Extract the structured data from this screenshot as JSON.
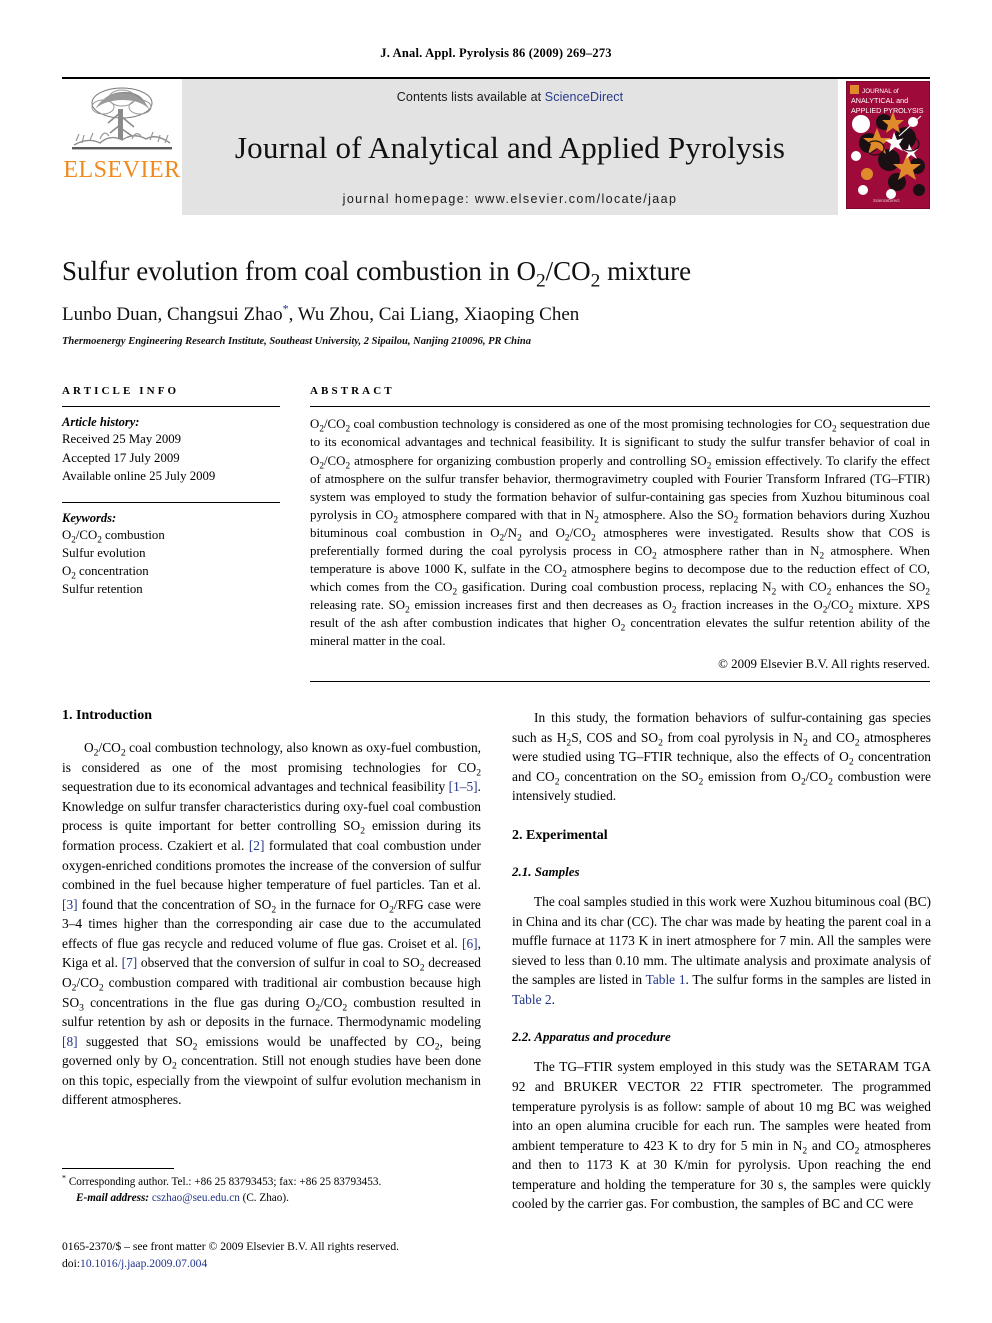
{
  "running_head": "J. Anal. Appl. Pyrolysis 86 (2009) 269–273",
  "masthead": {
    "publisher_name": "ELSEVIER",
    "publisher_logo_icon": "elsevier-tree-logo",
    "contents_prefix": "Contents lists available at ",
    "contents_link": "ScienceDirect",
    "journal_title": "Journal of Analytical and Applied Pyrolysis",
    "homepage_label": "journal homepage: www.elsevier.com/locate/jaap",
    "cover": {
      "line1": "JOURNAL of",
      "line2": "ANALYTICAL and",
      "line3": "APPLIED PYROLYSIS",
      "bg_color": "#9e0b3a",
      "accent_color": "#e08b2b"
    }
  },
  "article": {
    "title_parts": {
      "a": "Sulfur evolution from coal combustion in O",
      "sub1": "2",
      "b": "/CO",
      "sub2": "2",
      "c": " mixture"
    },
    "title_plain": "Sulfur evolution from coal combustion in O2/CO2 mixture",
    "authors": "Lunbo Duan, Changsui Zhao",
    "authors_rest": ", Wu Zhou, Cai Liang, Xiaoping Chen",
    "corresponding_marker": "*",
    "affiliation": "Thermoenergy Engineering Research Institute, Southeast University, 2 Sipailou, Nanjing 210096, PR China"
  },
  "article_info": {
    "heading": "ARTICLE INFO",
    "history_label": "Article history:",
    "history": [
      "Received 25 May 2009",
      "Accepted 17 July 2009",
      "Available online 25 July 2009"
    ],
    "keywords_label": "Keywords:",
    "keywords": [
      "O2/CO2 combustion",
      "Sulfur evolution",
      "O2 concentration",
      "Sulfur retention"
    ]
  },
  "abstract": {
    "heading": "ABSTRACT",
    "text": "O2/CO2 coal combustion technology is considered as one of the most promising technologies for CO2 sequestration due to its economical advantages and technical feasibility. It is significant to study the sulfur transfer behavior of coal in O2/CO2 atmosphere for organizing combustion properly and controlling SO2 emission effectively. To clarify the effect of atmosphere on the sulfur transfer behavior, thermogravimetry coupled with Fourier Transform Infrared (TG–FTIR) system was employed to study the formation behavior of sulfur-containing gas species from Xuzhou bituminous coal pyrolysis in CO2 atmosphere compared with that in N2 atmosphere. Also the SO2 formation behaviors during Xuzhou bituminous coal combustion in O2/N2 and O2/CO2 atmospheres were investigated. Results show that COS is preferentially formed during the coal pyrolysis process in CO2 atmosphere rather than in N2 atmosphere. When temperature is above 1000 K, sulfate in the CO2 atmosphere begins to decompose due to the reduction effect of CO, which comes from the CO2 gasification. During coal combustion process, replacing N2 with CO2 enhances the SO2 releasing rate. SO2 emission increases first and then decreases as O2 fraction increases in the O2/CO2 mixture. XPS result of the ash after combustion indicates that higher O2 concentration elevates the sulfur retention ability of the mineral matter in the coal.",
    "copyright": "© 2009 Elsevier B.V. All rights reserved."
  },
  "sections": {
    "introduction_heading": "1. Introduction",
    "intro_para": "O2/CO2 coal combustion technology, also known as oxy-fuel combustion, is considered as one of the most promising technologies for CO2 sequestration due to its economical advantages and technical feasibility [1–5]. Knowledge on sulfur transfer characteristics during oxy-fuel coal combustion process is quite important for better controlling SO2 emission during its formation process. Czakiert et al. [2] formulated that coal combustion under oxygen-enriched conditions promotes the increase of the conversion of sulfur combined in the fuel because higher temperature of fuel particles. Tan et al. [3] found that the concentration of SO2 in the furnace for O2/RFG case were 3–4 times higher than the corresponding air case due to the accumulated effects of flue gas recycle and reduced volume of flue gas. Croiset et al. [6], Kiga et al. [7] observed that the conversion of sulfur in coal to SO2 decreased O2/CO2 combustion compared with traditional air combustion because high SO3 concentrations in the flue gas during O2/CO2 combustion resulted in sulfur retention by ash or deposits in the furnace. Thermodynamic modeling [8] suggested that SO2 emissions would be unaffected by CO2, being governed only by O2 concentration. Still not enough studies have been done on this topic, especially from the viewpoint of sulfur evolution mechanism in different atmospheres.",
    "study_para": "In this study, the formation behaviors of sulfur-containing gas species such as H2S, COS and SO2 from coal pyrolysis in N2 and CO2 atmospheres were studied using TG–FTIR technique, also the effects of O2 concentration and CO2 concentration on the SO2 emission from O2/CO2 combustion were intensively studied.",
    "experimental_heading": "2. Experimental",
    "samples_heading": "2.1. Samples",
    "samples_para": "The coal samples studied in this work were Xuzhou bituminous coal (BC) in China and its char (CC). The char was made by heating the parent coal in a muffle furnace at 1173 K in inert atmosphere for 7 min. All the samples were sieved to less than 0.10 mm. The ultimate analysis and proximate analysis of the samples are listed in Table 1. The sulfur forms in the samples are listed in Table 2.",
    "apparatus_heading": "2.2. Apparatus and procedure",
    "apparatus_para": "The TG–FTIR system employed in this study was the SETARAM TGA 92 and BRUKER VECTOR 22 FTIR spectrometer. The programmed temperature pyrolysis is as follow: sample of about 10 mg BC was weighed into an open alumina crucible for each run. The samples were heated from ambient temperature to 423 K to dry for 5 min in N2 and CO2 atmospheres and then to 1173 K at 30 K/min for pyrolysis. Upon reaching the end temperature and holding the temperature for 30 s, the samples were quickly cooled by the carrier gas. For combustion, the samples of BC and CC were"
  },
  "footnote": {
    "marker": "*",
    "line1": "Corresponding author. Tel.: +86 25 83793453; fax: +86 25 83793453.",
    "email_label": "E-mail address:",
    "email": "cszhao@seu.edu.cn",
    "email_suffix": " (C. Zhao)."
  },
  "footer": {
    "issn_line": "0165-2370/$ – see front matter © 2009 Elsevier B.V. All rights reserved.",
    "doi_label": "doi:",
    "doi": "10.1016/j.jaap.2009.07.004"
  },
  "colors": {
    "link_blue": "#20338a",
    "elsevier_orange": "#F08A1E",
    "band_gray": "#e3e3e3"
  }
}
